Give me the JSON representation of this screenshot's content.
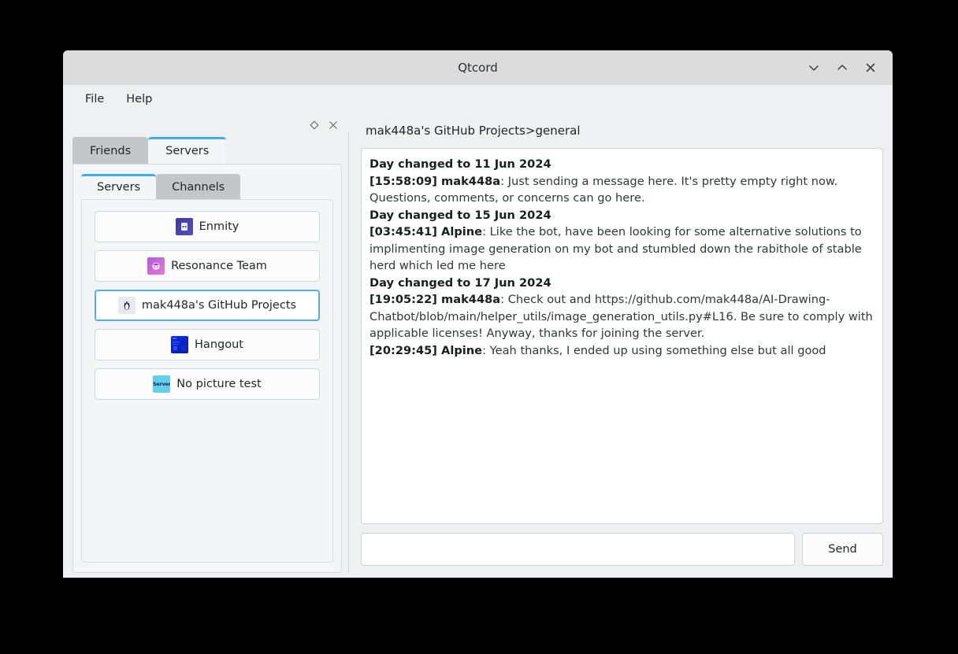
{
  "window": {
    "title": "Qtcord",
    "controls": [
      {
        "name": "minimize",
        "glyph": "chevron-down"
      },
      {
        "name": "maximize",
        "glyph": "chevron-up"
      },
      {
        "name": "close",
        "glyph": "x"
      }
    ]
  },
  "menubar": {
    "items": [
      {
        "label": "File"
      },
      {
        "label": "Help"
      }
    ]
  },
  "dock": {
    "float_icon": "diamond",
    "close_icon": "x",
    "tabs": [
      {
        "label": "Friends",
        "active": false
      },
      {
        "label": "Servers",
        "active": true
      }
    ],
    "sub_tabs": [
      {
        "label": "Servers",
        "active": true
      },
      {
        "label": "Channels",
        "active": false
      }
    ],
    "servers": [
      {
        "label": "Enmity",
        "icon": "enmity-server-icon",
        "selected": false
      },
      {
        "label": "Resonance Team",
        "icon": "resonance-team-server-icon",
        "selected": false
      },
      {
        "label": "mak448a's GitHub Projects",
        "icon": "github-projects-server-icon",
        "selected": true
      },
      {
        "label": "Hangout",
        "icon": "hangout-server-icon",
        "selected": false
      },
      {
        "label": "No picture test",
        "icon": "no-picture-server-icon",
        "icon_text": "Server",
        "selected": false
      }
    ]
  },
  "chat": {
    "channel_header": "mak448a's GitHub Projects>general",
    "messages": [
      {
        "type": "daychange",
        "text": "Day changed to 11 Jun 2024"
      },
      {
        "type": "message",
        "timestamp": "[15:58:09]",
        "author": "mak448a",
        "text": "Just sending a message here. It's pretty empty right now. Questions, comments, or concerns can go here."
      },
      {
        "type": "daychange",
        "text": "Day changed to 15 Jun 2024"
      },
      {
        "type": "message",
        "timestamp": "[03:45:41]",
        "author": "Alpine",
        "text": "Like the bot, have been looking for some alternative solutions to implimenting image generation on my bot and stumbled down the rabithole of stable herd which led me here"
      },
      {
        "type": "daychange",
        "text": "Day changed to 17 Jun 2024"
      },
      {
        "type": "message",
        "timestamp": "[19:05:22]",
        "author": "mak448a",
        "text": "Check out and https://github.com/mak448a/AI-Drawing-Chatbot/blob/main/helper_utils/image_generation_utils.py#L16. Be sure to comply with applicable licenses! Anyway, thanks for joining the server."
      },
      {
        "type": "message",
        "timestamp": "[20:29:45]",
        "author": "Alpine",
        "text": "Yeah thanks, I ended up using something else but all good"
      }
    ],
    "input_value": "",
    "input_placeholder": "",
    "send_label": "Send"
  },
  "colors": {
    "accent": "#3daee9",
    "selected_border": "#5babde",
    "titlebar": "#dcdcdc",
    "background": "#eff0f1",
    "panel": "#f4f5f6",
    "text": "#232629"
  }
}
